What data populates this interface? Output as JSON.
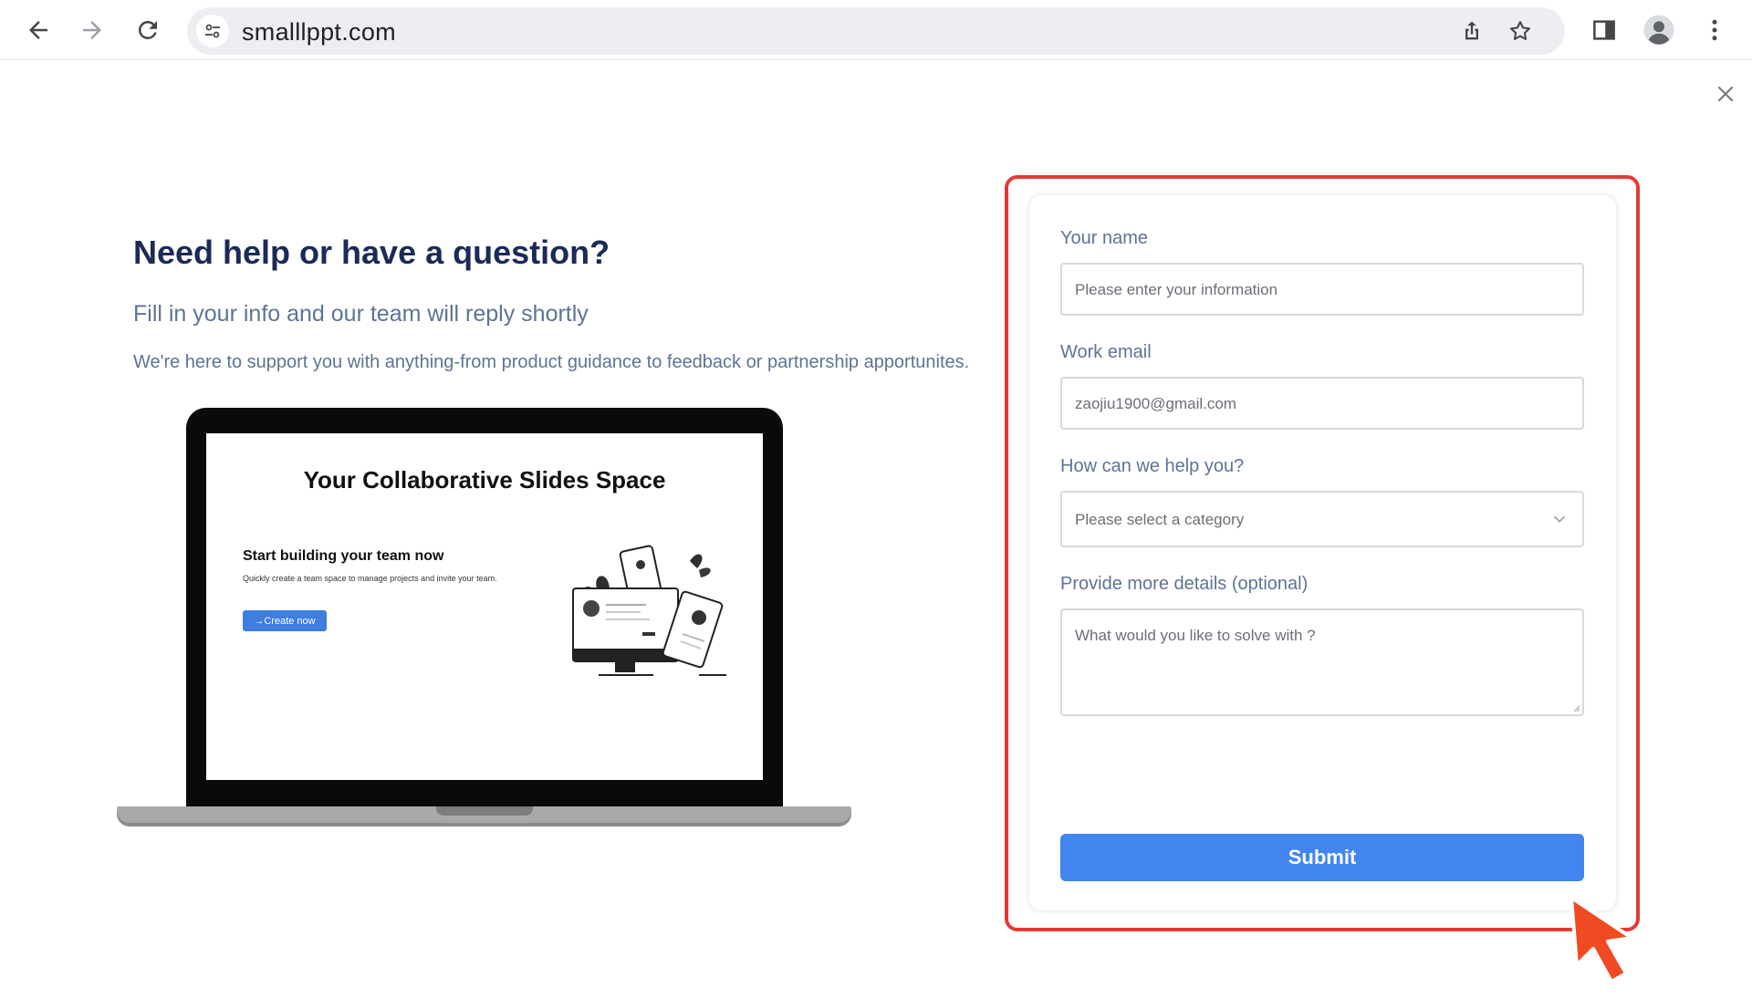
{
  "browser": {
    "url": "smalllppt.com",
    "icons": [
      "back-arrow-icon",
      "forward-arrow-icon",
      "reload-icon",
      "site-info-icon",
      "share-icon",
      "bookmark-star-icon",
      "side-panel-icon",
      "profile-icon",
      "more-menu-icon"
    ]
  },
  "dialog": {
    "close_icon": "close-icon"
  },
  "intro": {
    "headline": "Need help or have a question?",
    "subheadline": "Fill in your info and our team will reply shortly",
    "support_text": "We're here to support you with anything-from product guidance to feedback or partnership apportunites."
  },
  "laptop_preview": {
    "title": "Your Collaborative Slides Space",
    "heading": "Start building your team now",
    "description": "Quickly create a team space to manage projects and invite your team.",
    "button_label": "→Create now"
  },
  "form": {
    "name_label": "Your name",
    "name_placeholder": "Please enter your information",
    "email_label": "Work email",
    "email_value": "zaojiu1900@gmail.com",
    "help_label": "How can we help you?",
    "help_selected": "Please select a category",
    "details_label": "Provide more details (optional)",
    "details_placeholder": "What would you like to solve with ?",
    "submit_label": "Submit"
  },
  "colors": {
    "accent": "#4285ee",
    "highlight": "#e53935",
    "heading": "#1b2a57",
    "muted_text": "#5e7395",
    "cursor": "#f04a23"
  }
}
